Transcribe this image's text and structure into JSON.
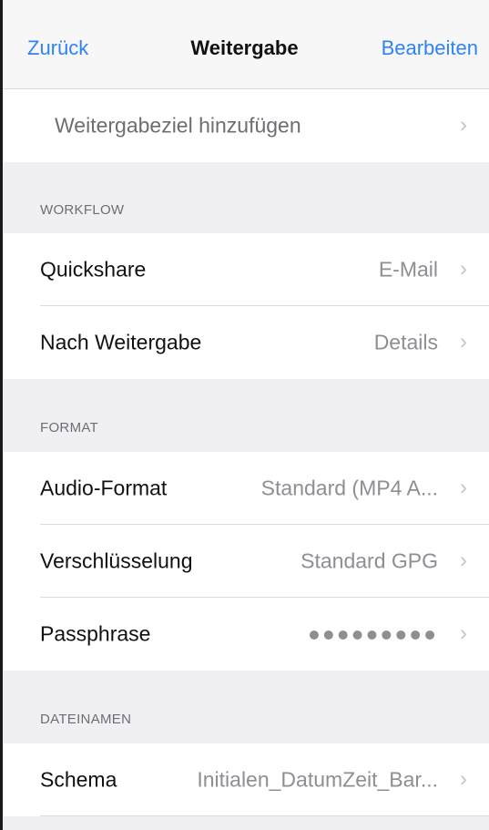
{
  "navbar": {
    "back_label": "Zurück",
    "title": "Weitergabe",
    "edit_label": "Bearbeiten"
  },
  "add_target": {
    "label": "Weitergabeziel hinzufügen"
  },
  "sections": {
    "workflow": {
      "header": "WORKFLOW",
      "quickshare": {
        "label": "Quickshare",
        "value": "E-Mail"
      },
      "after_share": {
        "label": "Nach Weitergabe",
        "value": "Details"
      }
    },
    "format": {
      "header": "FORMAT",
      "audio_format": {
        "label": "Audio-Format",
        "value": "Standard (MP4 A..."
      },
      "encryption": {
        "label": "Verschlüsselung",
        "value": "Standard GPG"
      },
      "passphrase": {
        "label": "Passphrase",
        "value": "●●●●●●●●●"
      }
    },
    "filenames": {
      "header": "DATEINAMEN",
      "schema": {
        "label": "Schema",
        "value": "Initialen_DatumZeit_Bar..."
      }
    }
  },
  "chevron": "›",
  "colors": {
    "accent": "#2f83f3",
    "background": "#efeff4",
    "separator": "#dcdce0"
  }
}
